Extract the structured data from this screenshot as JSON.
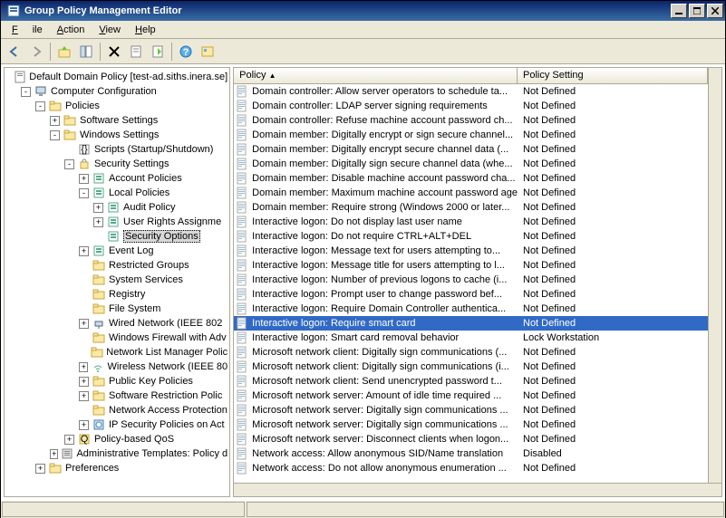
{
  "window": {
    "title": "Group Policy Management Editor"
  },
  "menu": {
    "file": "File",
    "action": "Action",
    "view": "View",
    "help": "Help"
  },
  "tree": [
    {
      "depth": 0,
      "exp": "",
      "icon": "doc",
      "label": "Default Domain Policy [test-ad.siths.inera.se]"
    },
    {
      "depth": 1,
      "exp": "-",
      "icon": "comp",
      "label": "Computer Configuration"
    },
    {
      "depth": 2,
      "exp": "-",
      "icon": "folder",
      "label": "Policies"
    },
    {
      "depth": 3,
      "exp": "+",
      "icon": "folder",
      "label": "Software Settings"
    },
    {
      "depth": 3,
      "exp": "-",
      "icon": "folder",
      "label": "Windows Settings"
    },
    {
      "depth": 4,
      "exp": "",
      "icon": "script",
      "label": "Scripts (Startup/Shutdown)"
    },
    {
      "depth": 4,
      "exp": "-",
      "icon": "sec",
      "label": "Security Settings"
    },
    {
      "depth": 5,
      "exp": "+",
      "icon": "pol",
      "label": "Account Policies"
    },
    {
      "depth": 5,
      "exp": "-",
      "icon": "pol",
      "label": "Local Policies"
    },
    {
      "depth": 6,
      "exp": "+",
      "icon": "pol",
      "label": "Audit Policy"
    },
    {
      "depth": 6,
      "exp": "+",
      "icon": "pol",
      "label": "User Rights Assignme"
    },
    {
      "depth": 6,
      "exp": "",
      "icon": "pol",
      "label": "Security Options",
      "selected": true
    },
    {
      "depth": 5,
      "exp": "+",
      "icon": "pol",
      "label": "Event Log"
    },
    {
      "depth": 5,
      "exp": "",
      "icon": "folder",
      "label": "Restricted Groups"
    },
    {
      "depth": 5,
      "exp": "",
      "icon": "folder",
      "label": "System Services"
    },
    {
      "depth": 5,
      "exp": "",
      "icon": "folder",
      "label": "Registry"
    },
    {
      "depth": 5,
      "exp": "",
      "icon": "folder",
      "label": "File System"
    },
    {
      "depth": 5,
      "exp": "+",
      "icon": "wired",
      "label": "Wired Network (IEEE 802"
    },
    {
      "depth": 5,
      "exp": "",
      "icon": "folder",
      "label": "Windows Firewall with Adv"
    },
    {
      "depth": 5,
      "exp": "",
      "icon": "folder",
      "label": "Network List Manager Polic"
    },
    {
      "depth": 5,
      "exp": "+",
      "icon": "wifi",
      "label": "Wireless Network (IEEE 80"
    },
    {
      "depth": 5,
      "exp": "+",
      "icon": "folder",
      "label": "Public Key Policies"
    },
    {
      "depth": 5,
      "exp": "+",
      "icon": "folder",
      "label": "Software Restriction Polic"
    },
    {
      "depth": 5,
      "exp": "",
      "icon": "folder",
      "label": "Network Access Protection"
    },
    {
      "depth": 5,
      "exp": "+",
      "icon": "ipsec",
      "label": "IP Security Policies on Act"
    },
    {
      "depth": 4,
      "exp": "+",
      "icon": "qos",
      "label": "Policy-based QoS"
    },
    {
      "depth": 3,
      "exp": "+",
      "icon": "adm",
      "label": "Administrative Templates: Policy d"
    },
    {
      "depth": 2,
      "exp": "+",
      "icon": "folder",
      "label": "Preferences"
    }
  ],
  "list_header": {
    "policy": "Policy",
    "setting": "Policy Setting"
  },
  "policies": [
    {
      "name": "Domain controller: Allow server operators to schedule ta...",
      "setting": "Not Defined"
    },
    {
      "name": "Domain controller: LDAP server signing requirements",
      "setting": "Not Defined"
    },
    {
      "name": "Domain controller: Refuse machine account password ch...",
      "setting": "Not Defined"
    },
    {
      "name": "Domain member: Digitally encrypt or sign secure channel...",
      "setting": "Not Defined"
    },
    {
      "name": "Domain member: Digitally encrypt secure channel data (...",
      "setting": "Not Defined"
    },
    {
      "name": "Domain member: Digitally sign secure channel data (whe...",
      "setting": "Not Defined"
    },
    {
      "name": "Domain member: Disable machine account password cha...",
      "setting": "Not Defined"
    },
    {
      "name": "Domain member: Maximum machine account password age",
      "setting": "Not Defined"
    },
    {
      "name": "Domain member: Require strong (Windows 2000 or later...",
      "setting": "Not Defined"
    },
    {
      "name": "Interactive logon: Do not display last user name",
      "setting": "Not Defined"
    },
    {
      "name": "Interactive logon: Do not require CTRL+ALT+DEL",
      "setting": "Not Defined"
    },
    {
      "name": "Interactive logon: Message text for users attempting to...",
      "setting": "Not Defined"
    },
    {
      "name": "Interactive logon: Message title for users attempting to l...",
      "setting": "Not Defined"
    },
    {
      "name": "Interactive logon: Number of previous logons to cache (i...",
      "setting": "Not Defined"
    },
    {
      "name": "Interactive logon: Prompt user to change password bef...",
      "setting": "Not Defined"
    },
    {
      "name": "Interactive logon: Require Domain Controller authentica...",
      "setting": "Not Defined"
    },
    {
      "name": "Interactive logon: Require smart card",
      "setting": "Not Defined",
      "selected": true
    },
    {
      "name": "Interactive logon: Smart card removal behavior",
      "setting": "Lock Workstation"
    },
    {
      "name": "Microsoft network client: Digitally sign communications (...",
      "setting": "Not Defined"
    },
    {
      "name": "Microsoft network client: Digitally sign communications (i...",
      "setting": "Not Defined"
    },
    {
      "name": "Microsoft network client: Send unencrypted password t...",
      "setting": "Not Defined"
    },
    {
      "name": "Microsoft network server: Amount of idle time required ...",
      "setting": "Not Defined"
    },
    {
      "name": "Microsoft network server: Digitally sign communications ...",
      "setting": "Not Defined"
    },
    {
      "name": "Microsoft network server: Digitally sign communications ...",
      "setting": "Not Defined"
    },
    {
      "name": "Microsoft network server: Disconnect clients when logon...",
      "setting": "Not Defined"
    },
    {
      "name": "Network access: Allow anonymous SID/Name translation",
      "setting": "Disabled"
    },
    {
      "name": "Network access: Do not allow anonymous enumeration ...",
      "setting": "Not Defined"
    }
  ]
}
